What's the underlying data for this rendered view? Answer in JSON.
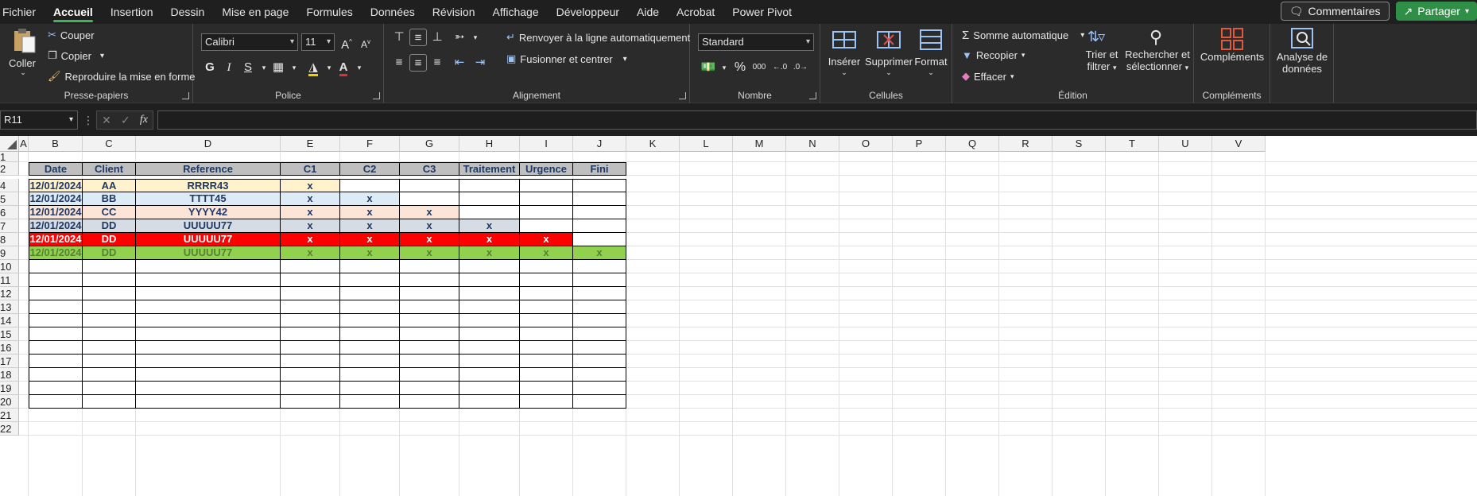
{
  "menu": {
    "items": [
      "Fichier",
      "Accueil",
      "Insertion",
      "Dessin",
      "Mise en page",
      "Formules",
      "Données",
      "Révision",
      "Affichage",
      "Développeur",
      "Aide",
      "Acrobat",
      "Power Pivot"
    ],
    "active": "Accueil",
    "comments_label": "Commentaires",
    "share_label": "Partager"
  },
  "ribbon": {
    "clipboard": {
      "paste": "Coller",
      "cut": "Couper",
      "copy": "Copier",
      "format_painter": "Reproduire la mise en forme",
      "label": "Presse-papiers"
    },
    "font": {
      "name": "Calibri",
      "size": "11",
      "bold": "G",
      "italic": "I",
      "underline": "S",
      "label": "Police"
    },
    "alignment": {
      "wrap": "Renvoyer à la ligne automatiquement",
      "merge": "Fusionner et centrer",
      "label": "Alignement"
    },
    "number": {
      "format": "Standard",
      "percent": "%",
      "thousands": "000",
      "label": "Nombre"
    },
    "cells": {
      "insert": "Insérer",
      "delete": "Supprimer",
      "format": "Format",
      "label": "Cellules"
    },
    "editing": {
      "autosum": "Somme automatique",
      "fill": "Recopier",
      "clear": "Effacer",
      "sort_l1": "Trier et",
      "sort_l2": "filtrer",
      "find_l1": "Rechercher et",
      "find_l2": "sélectionner",
      "label": "Édition"
    },
    "addins": {
      "button": "Compléments",
      "label": "Compléments"
    },
    "analysis": {
      "l1": "Analyse de",
      "l2": "données"
    }
  },
  "formula_bar": {
    "name_box": "R11",
    "fx": "fx",
    "value": ""
  },
  "sheet": {
    "columns": [
      "A",
      "B",
      "C",
      "D",
      "E",
      "F",
      "G",
      "H",
      "I",
      "J",
      "K",
      "L",
      "M",
      "N",
      "O",
      "P",
      "Q",
      "R",
      "S",
      "T",
      "U",
      "V"
    ],
    "rows": [
      "1",
      "2",
      "4",
      "5",
      "6",
      "7",
      "8",
      "9",
      "10",
      "11",
      "12",
      "13",
      "14",
      "15",
      "16",
      "17",
      "18",
      "19",
      "20",
      "21",
      "22"
    ],
    "header": [
      "Date",
      "Client",
      "Reference",
      "C1",
      "C2",
      "C3",
      "Traitement",
      "Urgence",
      "Fini"
    ],
    "data_rows": [
      {
        "cells": [
          "12/01/2024",
          "AA",
          "RRRR43",
          "x",
          "",
          "",
          "",
          "",
          ""
        ],
        "fill": "#fff2cc",
        "fill_count": 4,
        "text": "#1f3864"
      },
      {
        "cells": [
          "12/01/2024",
          "BB",
          "TTTT45",
          "x",
          "x",
          "",
          "",
          "",
          ""
        ],
        "fill": "#ddebf7",
        "fill_count": 5,
        "text": "#1f3864"
      },
      {
        "cells": [
          "12/01/2024",
          "CC",
          "YYYY42",
          "x",
          "x",
          "x",
          "",
          "",
          ""
        ],
        "fill": "#fce4d6",
        "fill_count": 6,
        "text": "#1f3864"
      },
      {
        "cells": [
          "12/01/2024",
          "DD",
          "UUUUU77",
          "x",
          "x",
          "x",
          "x",
          "",
          ""
        ],
        "fill": "#d6dce4",
        "fill_count": 7,
        "text": "#1f3864"
      },
      {
        "cells": [
          "12/01/2024",
          "DD",
          "UUUUU77",
          "x",
          "x",
          "x",
          "x",
          "x",
          ""
        ],
        "fill": "#ff0000",
        "fill_count": 8,
        "text": "#ffffff"
      },
      {
        "cells": [
          "12/01/2024",
          "DD",
          "UUUUU77",
          "x",
          "x",
          "x",
          "x",
          "x",
          "x"
        ],
        "fill": "#92d050",
        "fill_count": 9,
        "text": "#548235"
      }
    ],
    "empty_row_count": 11,
    "colors": {
      "header_fill": "#bfbfbf",
      "text": "#1f3864"
    }
  }
}
